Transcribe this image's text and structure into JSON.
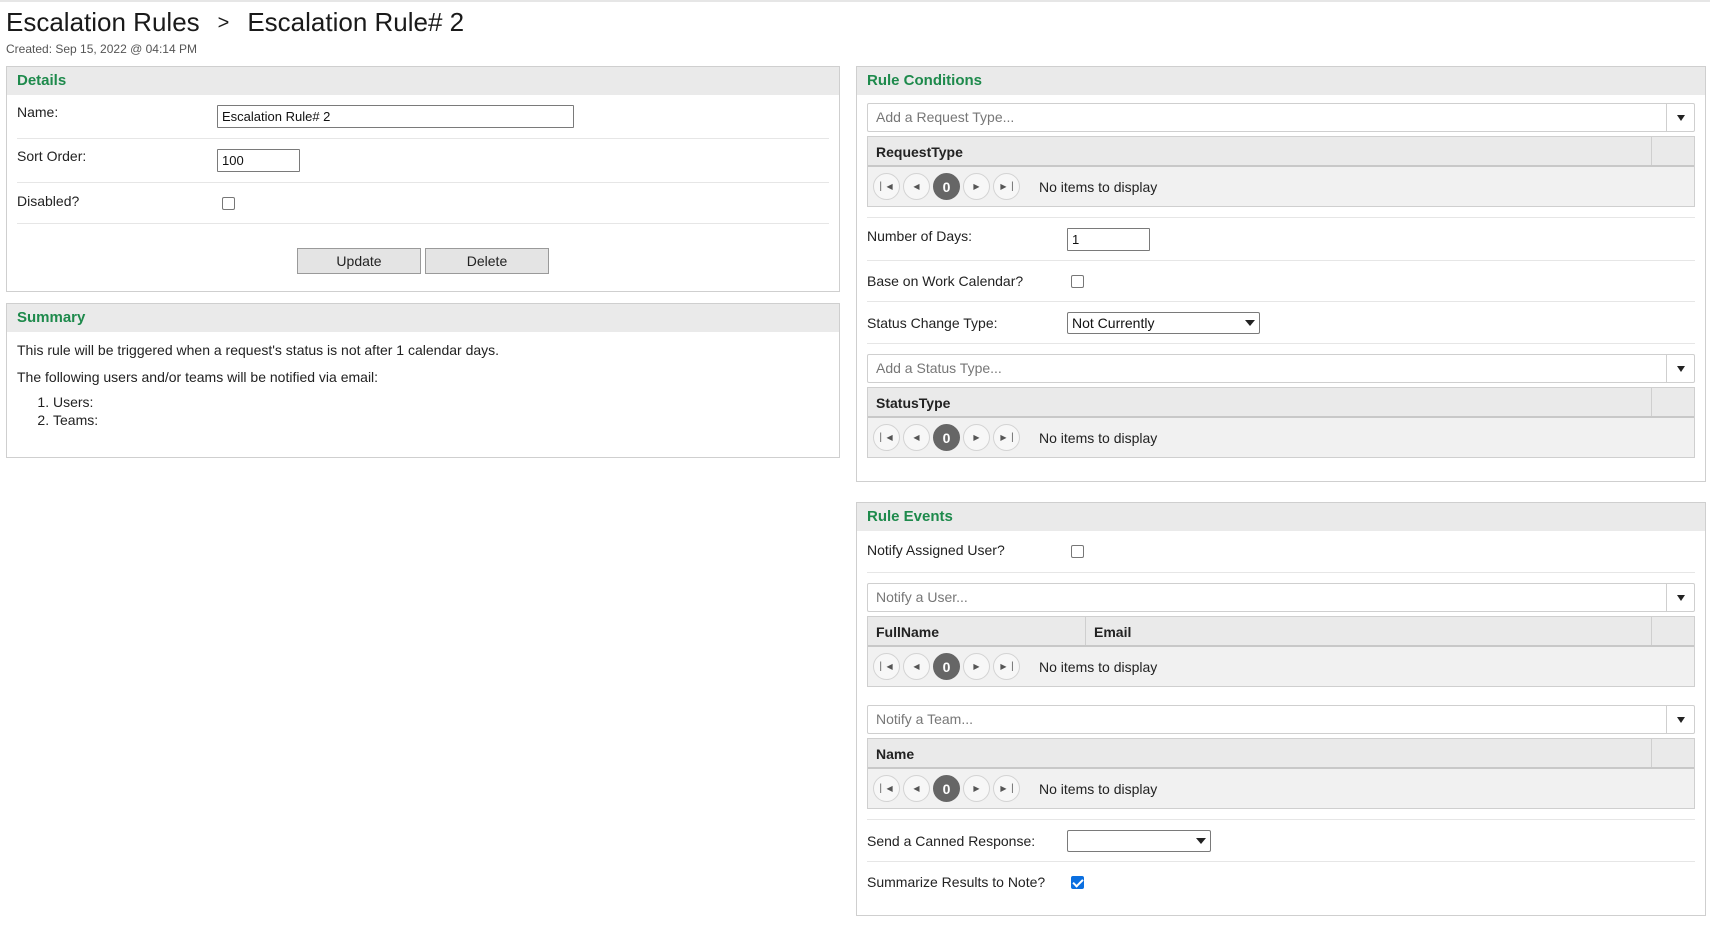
{
  "header": {
    "breadcrumb_parent": "Escalation Rules",
    "breadcrumb_sep": ">",
    "breadcrumb_current": "Escalation Rule# 2",
    "created": "Created: Sep 15, 2022 @ 04:14 PM"
  },
  "details": {
    "title": "Details",
    "name_label": "Name:",
    "name_value": "Escalation Rule# 2",
    "sort_label": "Sort Order:",
    "sort_value": "100",
    "disabled_label": "Disabled?",
    "disabled_checked": false,
    "update_label": "Update",
    "delete_label": "Delete"
  },
  "summary": {
    "title": "Summary",
    "line1": "This rule will be triggered when a request's status is not after 1 calendar days.",
    "line2": "The following users and/or teams will be notified via email:",
    "items": [
      "Users:",
      "Teams:"
    ]
  },
  "rule_conditions": {
    "title": "Rule Conditions",
    "request_type_placeholder": "Add a Request Type...",
    "request_grid": {
      "columns": [
        "RequestType"
      ],
      "page": "0",
      "empty": "No items to display"
    },
    "days_label": "Number of Days:",
    "days_value": "1",
    "work_calendar_label": "Base on Work Calendar?",
    "status_change_label": "Status Change Type:",
    "status_change_value": "Not Currently",
    "status_type_placeholder": "Add a Status Type...",
    "status_grid": {
      "columns": [
        "StatusType"
      ],
      "page": "0",
      "empty": "No items to display"
    }
  },
  "rule_events": {
    "title": "Rule Events",
    "notify_assigned_label": "Notify Assigned User?",
    "notify_user_placeholder": "Notify a User...",
    "user_grid": {
      "columns": [
        "FullName",
        "Email"
      ],
      "page": "0",
      "empty": "No items to display"
    },
    "notify_team_placeholder": "Notify a Team...",
    "team_grid": {
      "columns": [
        "Name"
      ],
      "page": "0",
      "empty": "No items to display"
    },
    "canned_label": "Send a Canned Response:",
    "canned_value": "",
    "summarize_label": "Summarize Results to Note?",
    "summarize_checked": true
  },
  "icons": {
    "first": "first-page-icon",
    "prev": "prev-page-icon",
    "next": "next-page-icon",
    "last": "last-page-icon",
    "caret": "chevron-down-icon"
  },
  "colors": {
    "section_title": "#1e8a4c",
    "checkbox_checked": "#0b6fe0"
  }
}
